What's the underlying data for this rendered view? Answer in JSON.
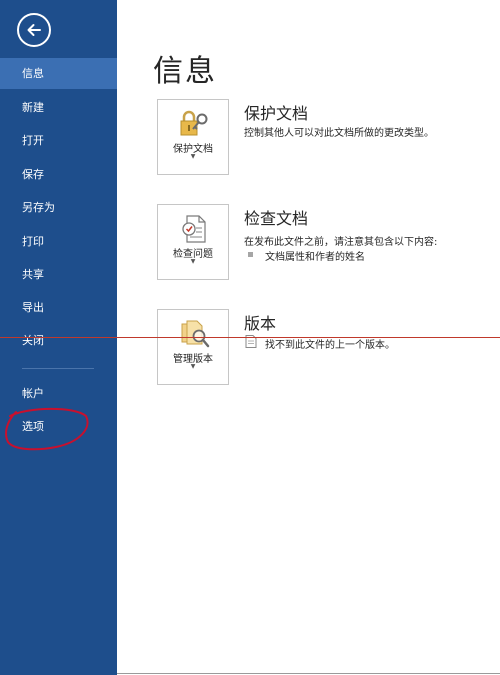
{
  "sidebar": {
    "back_icon": "arrow-left-circle-icon",
    "colors": {
      "background": "#1e4e8c",
      "active": "#3b6fb3"
    },
    "items": [
      {
        "label": "信息",
        "active": true
      },
      {
        "label": "新建"
      },
      {
        "label": "打开"
      },
      {
        "label": "保存"
      },
      {
        "label": "另存为"
      },
      {
        "label": "打印"
      },
      {
        "label": "共享"
      },
      {
        "label": "导出"
      },
      {
        "label": "关闭"
      }
    ],
    "bottom_items": [
      {
        "label": "帐户"
      },
      {
        "label": "选项"
      }
    ]
  },
  "main": {
    "title": "信息",
    "sections": [
      {
        "button_label": "保护文档",
        "button_icon": "lock-key-icon",
        "title": "保护文档",
        "description": "控制其他人可以对此文档所做的更改类型。"
      },
      {
        "button_label": "检查问题",
        "button_icon": "document-check-icon",
        "title": "检查文档",
        "description": "在发布此文件之前，请注意其包含以下内容:",
        "bullets": [
          "文档属性和作者的姓名"
        ]
      },
      {
        "button_label": "管理版本",
        "button_icon": "document-search-icon",
        "title": "版本",
        "description": "找不到此文件的上一个版本。"
      }
    ]
  },
  "annotations": {
    "highlight_color": "#c8102e"
  }
}
